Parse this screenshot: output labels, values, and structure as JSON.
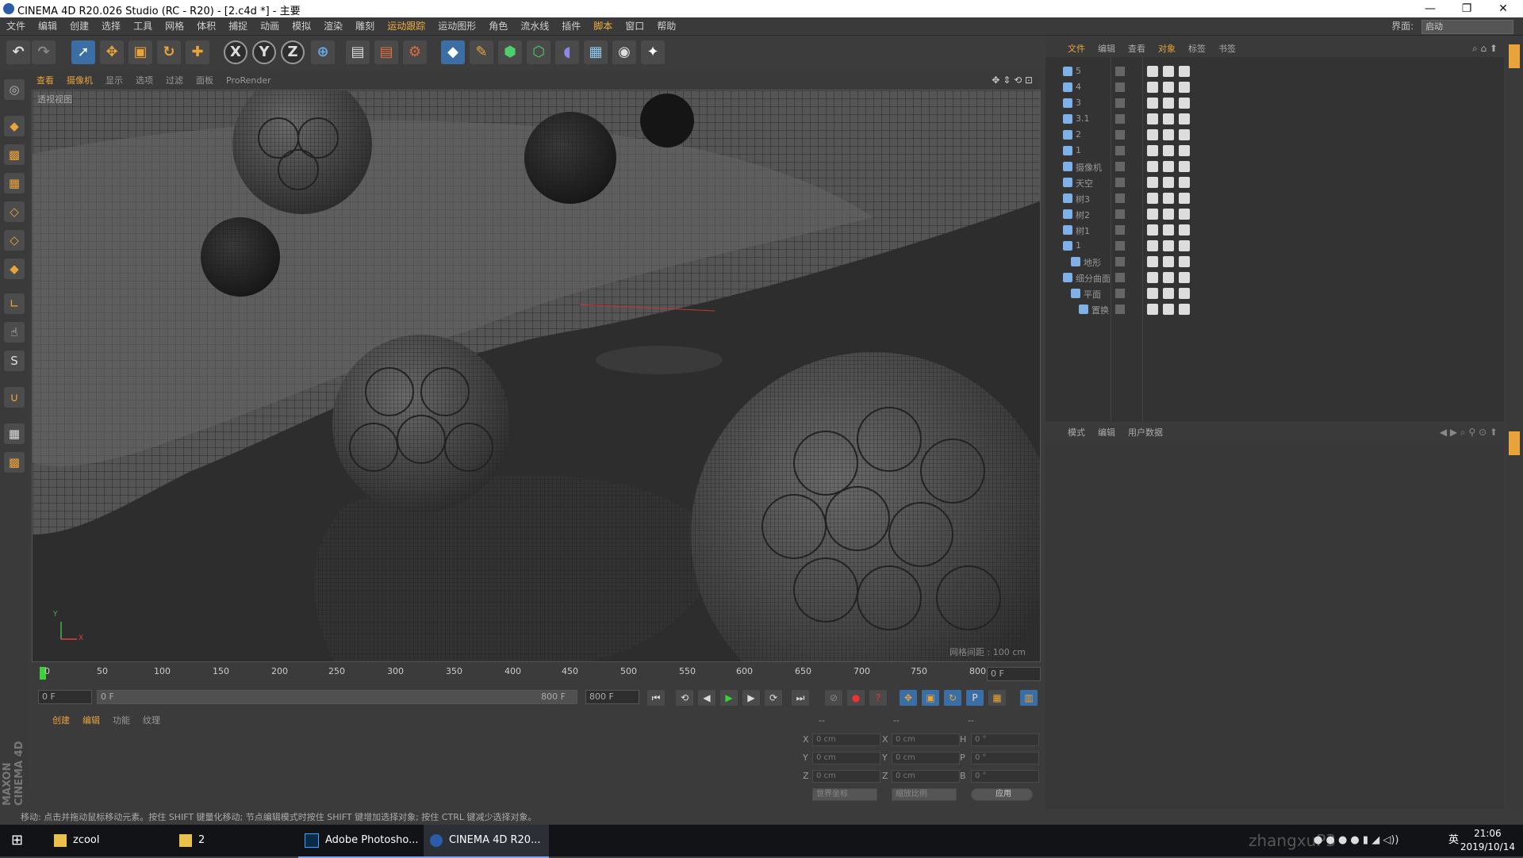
{
  "window": {
    "title": "CINEMA 4D R20.026 Studio (RC - R20) - [2.c4d *] - 主要",
    "min": "—",
    "max": "❐",
    "close": "✕"
  },
  "menu": {
    "items": [
      "文件",
      "编辑",
      "创建",
      "选择",
      "工具",
      "网格",
      "体积",
      "捕捉",
      "动画",
      "模拟",
      "渲染",
      "雕刻",
      "运动跟踪",
      "运动图形",
      "角色",
      "流水线",
      "插件",
      "脚本",
      "窗口",
      "帮助"
    ],
    "layout_label": "界面:",
    "layout_value": "启动"
  },
  "viewport": {
    "tabs": [
      "查看",
      "摄像机",
      "显示",
      "选项",
      "过滤",
      "面板",
      "ProRender"
    ],
    "view_name": "透视视图",
    "grid_spacing": "网格间距 : 100 cm",
    "axis_y": "Y",
    "axis_x": "X",
    "axis_z": "Z"
  },
  "timeline": {
    "ticks": [
      "0",
      "50",
      "100",
      "150",
      "200",
      "250",
      "300",
      "350",
      "400",
      "450",
      "500",
      "550",
      "600",
      "650",
      "700",
      "750",
      "800"
    ],
    "current_frame": "0 F",
    "start_frame": "0 F",
    "range_start": "0 F",
    "range_end": "800 F",
    "end_frame": "800 F"
  },
  "material_panel": {
    "tabs": [
      "创建",
      "编辑",
      "功能",
      "纹理"
    ]
  },
  "coords": {
    "headers": [
      "--",
      "--",
      "--"
    ],
    "rows": [
      {
        "a": "X",
        "av": "0 cm",
        "b": "X",
        "bv": "0 cm",
        "c": "H",
        "cv": "0 °"
      },
      {
        "a": "Y",
        "av": "0 cm",
        "b": "Y",
        "bv": "0 cm",
        "c": "P",
        "cv": "0 °"
      },
      {
        "a": "Z",
        "av": "0 cm",
        "b": "Z",
        "bv": "0 cm",
        "c": "B",
        "cv": "0 °"
      }
    ],
    "world": "世界坐标",
    "scale": "缩放比例",
    "apply": "应用"
  },
  "object_manager": {
    "tabs": [
      "文件",
      "编辑",
      "查看",
      "对象",
      "标签",
      "书签"
    ],
    "objects": [
      {
        "name": "5",
        "indent": 0
      },
      {
        "name": "4",
        "indent": 0
      },
      {
        "name": "3",
        "indent": 0
      },
      {
        "name": "3.1",
        "indent": 0
      },
      {
        "name": "2",
        "indent": 0
      },
      {
        "name": "1",
        "indent": 0
      },
      {
        "name": "摄像机",
        "indent": 0
      },
      {
        "name": "天空",
        "indent": 0
      },
      {
        "name": "树3",
        "indent": 0
      },
      {
        "name": "树2",
        "indent": 0
      },
      {
        "name": "树1",
        "indent": 0
      },
      {
        "name": "1",
        "indent": 0
      },
      {
        "name": "地形",
        "indent": 1
      },
      {
        "name": "细分曲面",
        "indent": 0
      },
      {
        "name": "平面",
        "indent": 1
      },
      {
        "name": "置换",
        "indent": 2
      }
    ]
  },
  "attributes": {
    "tabs": [
      "模式",
      "编辑",
      "用户数据"
    ]
  },
  "status": "移动: 点击并拖动鼠标移动元素。按住 SHIFT 键量化移动; 节点编辑模式时按住 SHIFT 键增加选择对象; 按住 CTRL 键减少选择对象。",
  "brand": "MAXON CINEMA 4D",
  "taskbar": {
    "items": [
      "zcool",
      "2",
      "Adobe Photosho...",
      "CINEMA 4D R20..."
    ],
    "watermark": "zhangxuP3",
    "ime": "英",
    "time": "21:06",
    "date": "2019/10/14"
  },
  "colors": {
    "accent": "#e9a33b",
    "panel": "#3b3b3b",
    "viewport_bg": "#2a2a2a",
    "taskbar": "#111317"
  }
}
